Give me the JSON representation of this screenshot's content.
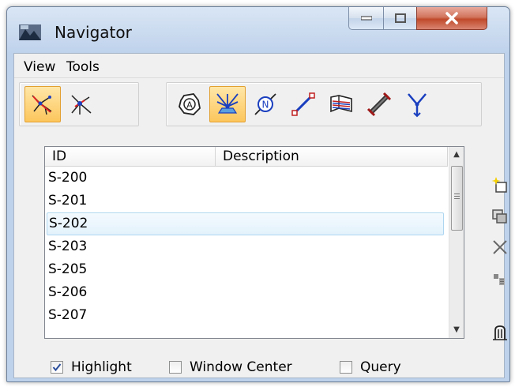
{
  "window": {
    "title": "Navigator",
    "icon": "navigator-app-icon",
    "controls": [
      "minimize-icon",
      "maximize-icon",
      "close-icon"
    ]
  },
  "menu": [
    {
      "label": "View"
    },
    {
      "label": "Tools"
    }
  ],
  "toolbar_left": [
    {
      "icon": "network-select-icon",
      "active": true
    },
    {
      "icon": "network-pick-icon",
      "active": false
    }
  ],
  "toolbar_right": [
    {
      "icon": "area-boundary-icon",
      "active": false
    },
    {
      "icon": "drainage-area-icon",
      "active": true
    },
    {
      "icon": "node-icon",
      "active": false
    },
    {
      "icon": "link-line-icon",
      "active": false
    },
    {
      "icon": "profile-icon",
      "active": false
    },
    {
      "icon": "culvert-icon",
      "active": false
    },
    {
      "icon": "junction-icon",
      "active": false
    }
  ],
  "list": {
    "columns": [
      {
        "label": "ID"
      },
      {
        "label": "Description"
      }
    ],
    "rows": [
      {
        "id": "S-200",
        "description": ""
      },
      {
        "id": "S-201",
        "description": ""
      },
      {
        "id": "S-202",
        "description": "",
        "selected": true
      },
      {
        "id": "S-203",
        "description": ""
      },
      {
        "id": "S-205",
        "description": ""
      },
      {
        "id": "S-206",
        "description": ""
      },
      {
        "id": "S-207",
        "description": ""
      }
    ]
  },
  "side_tools": [
    "new-item-icon",
    "copy-item-icon",
    "delete-icon",
    "properties-icon",
    "scan-icon"
  ],
  "options": [
    {
      "label": "Highlight",
      "checked": true
    },
    {
      "label": "Window Center",
      "checked": false
    },
    {
      "label": "Query",
      "checked": false
    }
  ],
  "colors": {
    "accent_active": "#fcc65c",
    "selection": "#e3f2fc",
    "close_button": "#c0492a"
  }
}
